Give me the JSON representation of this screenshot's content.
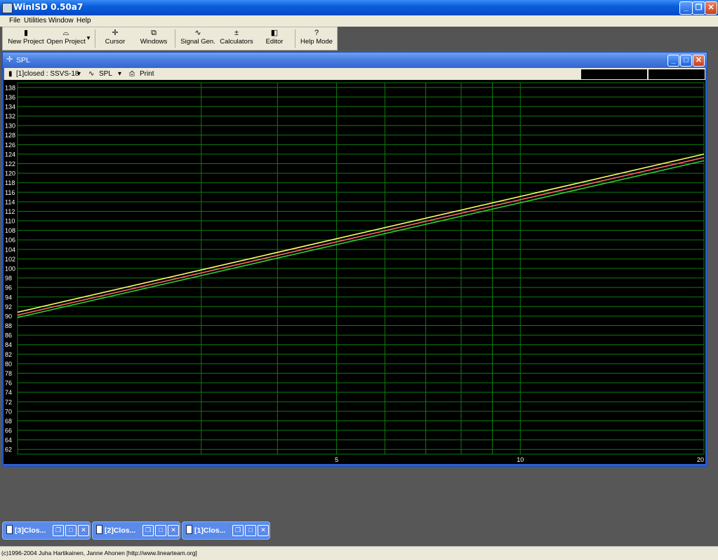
{
  "app": {
    "title": "WinISD 0.50a7"
  },
  "menu": {
    "file": "File",
    "utilities": "Utilities",
    "window": "Window",
    "help": "Help"
  },
  "toolbar": {
    "new_project": "New Project",
    "open_project": "Open Project",
    "cursor": "Cursor",
    "windows": "Windows",
    "signal_gen": "Signal Gen.",
    "calculators": "Calculators",
    "editor": "Editor",
    "help_mode": "Help Mode"
  },
  "spl_window": {
    "title": "SPL",
    "project_select": "[1]closed : SSVS-18",
    "graph_select": "SPL",
    "print": "Print"
  },
  "taskbar": [
    {
      "label": "[3]Clos..."
    },
    {
      "label": "[2]Clos..."
    },
    {
      "label": "[1]Clos..."
    }
  ],
  "status": {
    "text": "(c)1996-2004 Juha Hartikainen, Janne Ahonen [http://www.linearteam.org]"
  },
  "colors": {
    "grid": "#0c7d0c",
    "axis_text": "#ffffff",
    "plot_bg": "#000000",
    "series": [
      "#ffff66",
      "#ff6666",
      "#33cc33"
    ]
  },
  "chart_data": {
    "type": "line",
    "xscale": "log",
    "xlim": [
      1.5,
      20
    ],
    "ylim": [
      61,
      139
    ],
    "xticks": [
      {
        "value": 5,
        "label": "5"
      },
      {
        "value": 10,
        "label": "10"
      },
      {
        "value": 20,
        "label": "20"
      }
    ],
    "xgrid": [
      3,
      4,
      5,
      6,
      7,
      8,
      9,
      10,
      20
    ],
    "yticks": [
      62,
      64,
      66,
      68,
      70,
      72,
      74,
      76,
      78,
      80,
      82,
      84,
      86,
      88,
      90,
      92,
      94,
      96,
      98,
      100,
      102,
      104,
      106,
      108,
      110,
      112,
      114,
      116,
      118,
      120,
      122,
      124,
      126,
      128,
      130,
      132,
      134,
      136,
      138
    ],
    "series": [
      {
        "x": [
          1.5,
          20
        ],
        "y": [
          90.8,
          124
        ]
      },
      {
        "x": [
          1.5,
          20
        ],
        "y": [
          90.2,
          123.3
        ]
      },
      {
        "x": [
          1.5,
          20
        ],
        "y": [
          89.7,
          122.6
        ]
      }
    ],
    "grid": true
  }
}
